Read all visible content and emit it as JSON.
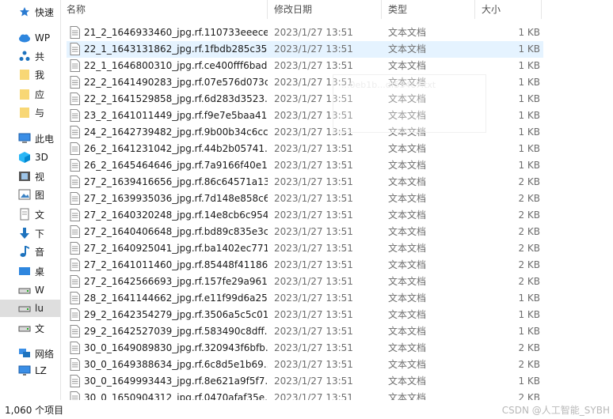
{
  "columns": {
    "name": "名称",
    "date": "修改日期",
    "type": "类型",
    "size": "大小"
  },
  "nav": [
    {
      "icon": "star-icon",
      "label": "快速"
    },
    {
      "icon": "cloud-icon",
      "label": "WP"
    },
    {
      "icon": "share-icon",
      "label": "共"
    },
    {
      "icon": "folder-icon",
      "label": "我"
    },
    {
      "icon": "folder-icon",
      "label": "应"
    },
    {
      "icon": "folder-icon",
      "label": "与"
    },
    {
      "icon": "computer-icon",
      "label": "此电"
    },
    {
      "icon": "cube-icon",
      "label": "3D"
    },
    {
      "icon": "video-icon",
      "label": "视"
    },
    {
      "icon": "picture-icon",
      "label": "图"
    },
    {
      "icon": "document-icon",
      "label": "文"
    },
    {
      "icon": "download-icon",
      "label": "下"
    },
    {
      "icon": "music-icon",
      "label": "音"
    },
    {
      "icon": "desktop-icon",
      "label": "桌"
    },
    {
      "icon": "drive-icon",
      "label": "W"
    },
    {
      "icon": "drive-icon",
      "label": "lu"
    },
    {
      "icon": "drive-icon",
      "label": "文"
    },
    {
      "icon": "network-icon",
      "label": "网络"
    },
    {
      "icon": "monitor-icon",
      "label": "LZ"
    }
  ],
  "files": [
    {
      "name": "21_2_1646933460_jpg.rf.110733eeece...",
      "date": "2023/1/27 13:51",
      "type": "文本文档",
      "size": "1 KB"
    },
    {
      "name": "22_1_1643131862_jpg.rf.1fbdb285c35...",
      "date": "2023/1/27 13:51",
      "type": "文本文档",
      "size": "1 KB"
    },
    {
      "name": "22_1_1646800310_jpg.rf.ce400fff6bad...",
      "date": "2023/1/27 13:51",
      "type": "文本文档",
      "size": "1 KB"
    },
    {
      "name": "22_2_1641490283_jpg.rf.07e576d073c...",
      "date": "2023/1/27 13:51",
      "type": "文本文档",
      "size": "1 KB"
    },
    {
      "name": "22_2_1641529858_jpg.rf.6d283d3523...",
      "date": "2023/1/27 13:51",
      "type": "文本文档",
      "size": "1 KB"
    },
    {
      "name": "23_2_1641011449_jpg.rf.f9e7e5baa41...",
      "date": "2023/1/27 13:51",
      "type": "文本文档",
      "size": "1 KB"
    },
    {
      "name": "24_2_1642739482_jpg.rf.9b00b34c6cc...",
      "date": "2023/1/27 13:51",
      "type": "文本文档",
      "size": "1 KB"
    },
    {
      "name": "26_2_1641231042_jpg.rf.44b2b05741...",
      "date": "2023/1/27 13:51",
      "type": "文本文档",
      "size": "1 KB"
    },
    {
      "name": "26_2_1645464646_jpg.rf.7a9166f40e1...",
      "date": "2023/1/27 13:51",
      "type": "文本文档",
      "size": "1 KB"
    },
    {
      "name": "27_2_1639416656_jpg.rf.86c64571a13...",
      "date": "2023/1/27 13:51",
      "type": "文本文档",
      "size": "2 KB"
    },
    {
      "name": "27_2_1639935036_jpg.rf.7d148e858c6...",
      "date": "2023/1/27 13:51",
      "type": "文本文档",
      "size": "2 KB"
    },
    {
      "name": "27_2_1640320248_jpg.rf.14e8cb6c954...",
      "date": "2023/1/27 13:51",
      "type": "文本文档",
      "size": "2 KB"
    },
    {
      "name": "27_2_1640406648_jpg.rf.bd89c835e3c...",
      "date": "2023/1/27 13:51",
      "type": "文本文档",
      "size": "2 KB"
    },
    {
      "name": "27_2_1640925041_jpg.rf.ba1402ec771...",
      "date": "2023/1/27 13:51",
      "type": "文本文档",
      "size": "2 KB"
    },
    {
      "name": "27_2_1641011460_jpg.rf.85448f41186...",
      "date": "2023/1/27 13:51",
      "type": "文本文档",
      "size": "2 KB"
    },
    {
      "name": "27_2_1642566693_jpg.rf.157fe29a961...",
      "date": "2023/1/27 13:51",
      "type": "文本文档",
      "size": "2 KB"
    },
    {
      "name": "28_2_1641144662_jpg.rf.e11f99d6a25...",
      "date": "2023/1/27 13:51",
      "type": "文本文档",
      "size": "1 KB"
    },
    {
      "name": "29_2_1642354279_jpg.rf.3506a5c5c01...",
      "date": "2023/1/27 13:51",
      "type": "文本文档",
      "size": "1 KB"
    },
    {
      "name": "29_2_1642527039_jpg.rf.583490c8dff...",
      "date": "2023/1/27 13:51",
      "type": "文本文档",
      "size": "1 KB"
    },
    {
      "name": "30_0_1649089830_jpg.rf.320943f6bfb...",
      "date": "2023/1/27 13:51",
      "type": "文本文档",
      "size": "2 KB"
    },
    {
      "name": "30_0_1649388634_jpg.rf.6c8d5e1b69...",
      "date": "2023/1/27 13:51",
      "type": "文本文档",
      "size": "2 KB"
    },
    {
      "name": "30_0_1649993443_jpg.rf.8e621a9f5f7...",
      "date": "2023/1/27 13:51",
      "type": "文本文档",
      "size": "1 KB"
    },
    {
      "name": "30_0_1650904312_jpg.rf.0470afaf35e...",
      "date": "2023/1/27 13:51",
      "type": "文本文档",
      "size": "2 KB"
    }
  ],
  "status": {
    "count": "1,060 个项目"
  },
  "watermark": "CSDN @人工智能_SYBH",
  "ghost_text": "...0eb1b...df534c7.txt"
}
